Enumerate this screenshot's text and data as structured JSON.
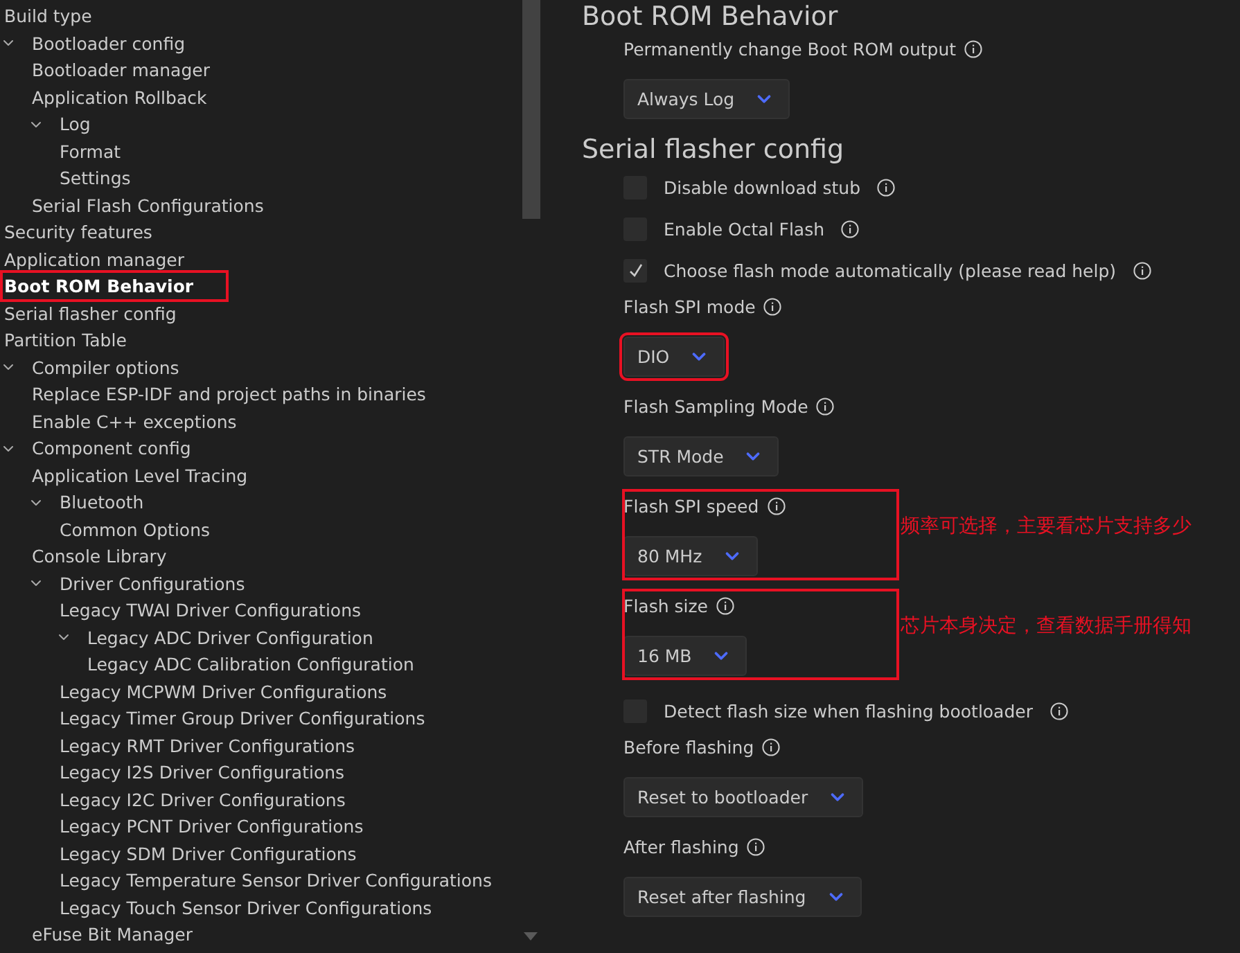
{
  "tree": [
    {
      "label": "Build type",
      "selected": false,
      "annotated": false
    },
    {
      "label": "Bootloader config",
      "selected": false,
      "annotated": false,
      "expanded": true,
      "children": [
        {
          "label": "Bootloader manager",
          "selected": false,
          "annotated": false
        },
        {
          "label": "Application Rollback",
          "selected": false,
          "annotated": false
        },
        {
          "label": "Log",
          "selected": false,
          "annotated": false,
          "expanded": true,
          "children": [
            {
              "label": "Format",
              "selected": false,
              "annotated": false
            },
            {
              "label": "Settings",
              "selected": false,
              "annotated": false
            }
          ]
        },
        {
          "label": "Serial Flash Configurations",
          "selected": false,
          "annotated": false
        }
      ]
    },
    {
      "label": "Security features",
      "selected": false,
      "annotated": false
    },
    {
      "label": "Application manager",
      "selected": false,
      "annotated": false
    },
    {
      "label": "Boot ROM Behavior",
      "selected": true,
      "annotated": true
    },
    {
      "label": "Serial flasher config",
      "selected": false,
      "annotated": false
    },
    {
      "label": "Partition Table",
      "selected": false,
      "annotated": false
    },
    {
      "label": "Compiler options",
      "selected": false,
      "annotated": false,
      "expanded": true,
      "children": [
        {
          "label": "Replace ESP-IDF and project paths in binaries",
          "selected": false,
          "annotated": false
        },
        {
          "label": "Enable C++ exceptions",
          "selected": false,
          "annotated": false
        }
      ]
    },
    {
      "label": "Component config",
      "selected": false,
      "annotated": false,
      "expanded": true,
      "children": [
        {
          "label": "Application Level Tracing",
          "selected": false,
          "annotated": false
        },
        {
          "label": "Bluetooth",
          "selected": false,
          "annotated": false,
          "expanded": true,
          "children": [
            {
              "label": "Common Options",
              "selected": false,
              "annotated": false
            }
          ]
        },
        {
          "label": "Console Library",
          "selected": false,
          "annotated": false
        },
        {
          "label": "Driver Configurations",
          "selected": false,
          "annotated": false,
          "expanded": true,
          "children": [
            {
              "label": "Legacy TWAI Driver Configurations",
              "selected": false,
              "annotated": false
            },
            {
              "label": "Legacy ADC Driver Configuration",
              "selected": false,
              "annotated": false,
              "expanded": true,
              "children": [
                {
                  "label": "Legacy ADC Calibration Configuration",
                  "selected": false,
                  "annotated": false
                }
              ]
            },
            {
              "label": "Legacy MCPWM Driver Configurations",
              "selected": false,
              "annotated": false
            },
            {
              "label": "Legacy Timer Group Driver Configurations",
              "selected": false,
              "annotated": false
            },
            {
              "label": "Legacy RMT Driver Configurations",
              "selected": false,
              "annotated": false
            },
            {
              "label": "Legacy I2S Driver Configurations",
              "selected": false,
              "annotated": false
            },
            {
              "label": "Legacy I2C Driver Configurations",
              "selected": false,
              "annotated": false
            },
            {
              "label": "Legacy PCNT Driver Configurations",
              "selected": false,
              "annotated": false
            },
            {
              "label": "Legacy SDM Driver Configurations",
              "selected": false,
              "annotated": false
            },
            {
              "label": "Legacy Temperature Sensor Driver Configurations",
              "selected": false,
              "annotated": false
            },
            {
              "label": "Legacy Touch Sensor Driver Configurations",
              "selected": false,
              "annotated": false
            }
          ]
        },
        {
          "label": "eFuse Bit Manager",
          "selected": false,
          "annotated": false
        }
      ]
    }
  ],
  "sections": [
    {
      "title": "Boot ROM Behavior",
      "settings": [
        {
          "kind": "select",
          "label": "Permanently change Boot ROM output",
          "value": "Always Log",
          "annotated": false
        }
      ]
    },
    {
      "title": "Serial flasher config",
      "settings": [
        {
          "kind": "checkbox",
          "label": "Disable download stub",
          "checked": false
        },
        {
          "kind": "checkbox",
          "label": "Enable Octal Flash",
          "checked": false
        },
        {
          "kind": "checkbox",
          "label": "Choose flash mode automatically (please read help)",
          "checked": true
        },
        {
          "kind": "select",
          "label": "Flash SPI mode",
          "value": "DIO",
          "annotated": false,
          "value_annotated": true
        },
        {
          "kind": "select",
          "label": "Flash Sampling Mode",
          "value": "STR Mode",
          "annotated": false
        },
        {
          "kind": "select",
          "label": "Flash SPI speed",
          "value": "80 MHz",
          "annotated": true,
          "note": "频率可选择，主要看芯片支持多少"
        },
        {
          "kind": "select",
          "label": "Flash size",
          "value": "16 MB",
          "annotated": true,
          "note": "芯片本身决定，查看数据手册得知"
        },
        {
          "kind": "checkbox",
          "label": "Detect flash size when flashing bootloader",
          "checked": false
        },
        {
          "kind": "select",
          "label": "Before flashing",
          "value": "Reset to bootloader",
          "annotated": false
        },
        {
          "kind": "select",
          "label": "After flashing",
          "value": "Reset after flashing",
          "annotated": false
        }
      ]
    }
  ]
}
